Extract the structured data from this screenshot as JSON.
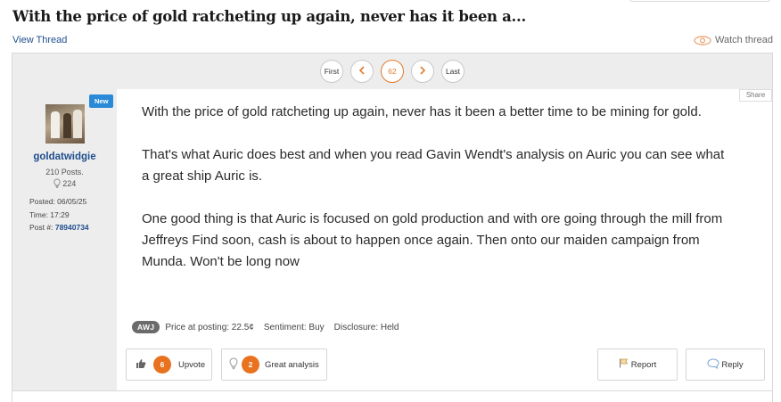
{
  "thread": {
    "title": "With the price of gold ratcheting up again, never has it been a...",
    "view_thread_label": "View Thread",
    "watch_label": "Watch thread"
  },
  "pagination": {
    "first_label": "First",
    "current_page": "62",
    "last_label": "Last",
    "prev_icon": "chevron-left-icon",
    "next_icon": "chevron-right-icon"
  },
  "author": {
    "badge": "New",
    "username": "goldatwidgie",
    "posts": "210 Posts.",
    "likes": "224",
    "posted": "Posted: 06/05/25",
    "time": "Time: 17:29",
    "post_number_label": "Post #:",
    "post_number": "78940734"
  },
  "post": {
    "share_label": "Share",
    "paragraphs": [
      "With the price of gold ratcheting up again, never has it been a better time to be mining for gold.",
      "That's what Auric does best and when you read Gavin Wendt's analysis on Auric you can see what a great ship Auric is.",
      "One good thing is that Auric is focused on gold production and with ore going through the mill from Jeffreys Find soon, cash is about to happen once again. Then onto our maiden campaign from Munda. Won't be long now"
    ],
    "ticker": "AWJ",
    "price_at_posting": "Price at posting: 22.5¢",
    "sentiment": "Sentiment: Buy",
    "disclosure": "Disclosure: Held"
  },
  "actions": {
    "upvote_count": "6",
    "upvote_label": "Upvote",
    "great_analysis_count": "2",
    "great_analysis_label": "Great analysis",
    "report_label": "Report",
    "reply_label": "Reply"
  },
  "colors": {
    "accent_orange": "#e8721f",
    "link_blue": "#1f4e8c",
    "badge_blue": "#2a8ad8"
  }
}
